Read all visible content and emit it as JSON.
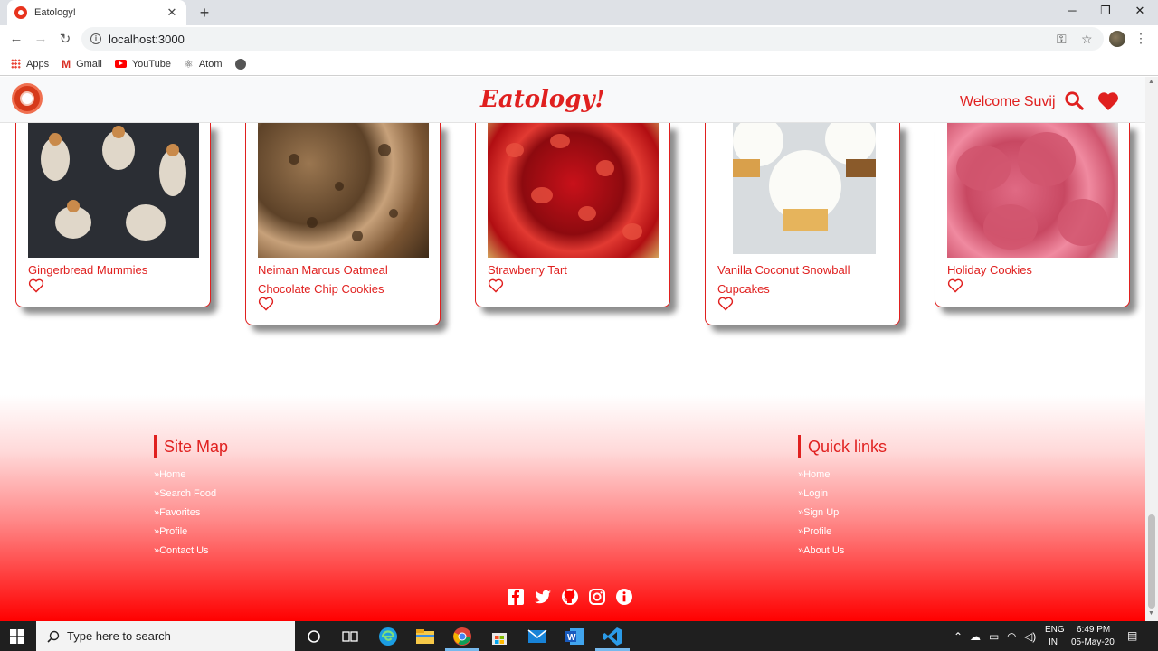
{
  "browser": {
    "tab_title": "Eatology!",
    "tab_close": "✕",
    "new_tab": "+",
    "url": "localhost:3000",
    "bookmarks": [
      "Apps",
      "Gmail",
      "YouTube",
      "Atom"
    ]
  },
  "header": {
    "brand": "Eatology!",
    "welcome": "Welcome Suvij"
  },
  "cards": [
    {
      "title": "Gingerbread Mummies"
    },
    {
      "title": "Neiman Marcus Oatmeal Chocolate Chip Cookies"
    },
    {
      "title": "Strawberry Tart"
    },
    {
      "title": "Vanilla Coconut Snowball Cupcakes"
    },
    {
      "title": "Holiday Cookies"
    }
  ],
  "footer": {
    "sitemap": {
      "heading": "Site Map",
      "links": [
        "»Home",
        "»Search Food",
        "»Favorites",
        "»Profile",
        "»Contact Us"
      ]
    },
    "quicklinks": {
      "heading": "Quick links",
      "links": [
        "»Home",
        "»Login",
        "»Sign Up",
        "»Profile",
        "»About Us"
      ]
    },
    "social_icons": [
      "facebook-icon",
      "twitter-icon",
      "github-icon",
      "instagram-icon",
      "info-icon"
    ]
  },
  "taskbar": {
    "search_placeholder": "Type here to search",
    "lang_top": "ENG",
    "lang_bottom": "IN",
    "time": "6:49 PM",
    "date": "05-May-20"
  },
  "colors": {
    "accent": "#e0201f",
    "footer_bottom": "#ff0000"
  }
}
